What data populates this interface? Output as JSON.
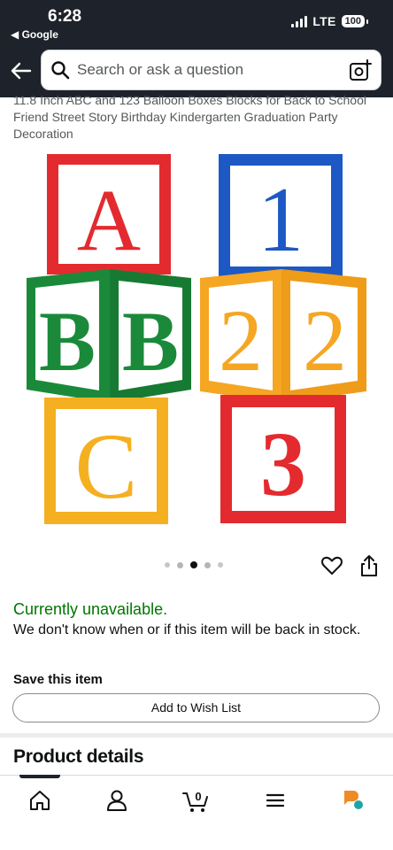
{
  "status_bar": {
    "time": "6:28",
    "back_app": "◀ Google",
    "network": "LTE",
    "battery": "100"
  },
  "header": {
    "back_icon": "arrow-left-icon",
    "search_placeholder": "Search or ask a question",
    "search_icon": "search-icon",
    "camera_icon": "camera-search-icon"
  },
  "product": {
    "title": "11.8 Inch ABC and 123 Balloon Boxes Blocks for Back to School Friend Street Story Birthday Kindergarten Graduation Party Decoration",
    "image": {
      "blocks": [
        {
          "letter": "A",
          "box_color": "#e32b2f",
          "letter_color": "#e32b2f"
        },
        {
          "letter": "B",
          "box_color": "#1a8a3a",
          "letter_color": "#1a8a3a"
        },
        {
          "letter": "C",
          "box_color": "#f5b021",
          "letter_color": "#f5b021"
        },
        {
          "letter": "1",
          "box_color": "#1d58c4",
          "letter_color": "#1d58c4"
        },
        {
          "letter": "2",
          "box_color": "#f5a623",
          "letter_color": "#f5a623"
        },
        {
          "letter": "3",
          "box_color": "#e32b2f",
          "letter_color": "#e32b2f"
        }
      ]
    },
    "carousel": {
      "count": 5,
      "active_index": 2
    }
  },
  "availability": {
    "status": "Currently unavailable.",
    "message": "We don't know when or if this item will be back in stock.",
    "status_color": "#007600"
  },
  "save": {
    "title": "Save this item",
    "wishlist_button": "Add to Wish List"
  },
  "details": {
    "title": "Product details"
  },
  "bottom_nav": {
    "items": [
      "home-icon",
      "account-icon",
      "cart-icon",
      "menu-icon",
      "rufus-icon"
    ],
    "cart_count": "0"
  }
}
